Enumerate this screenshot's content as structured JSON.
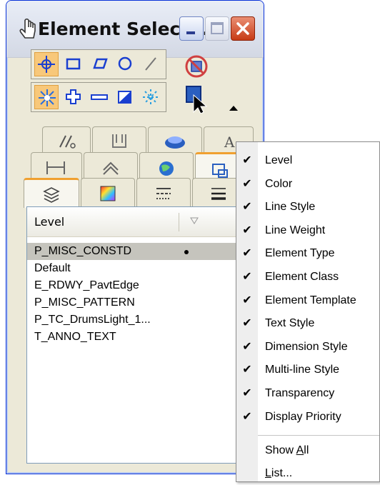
{
  "window": {
    "title": "Element Select...",
    "icon": "hand-pointer-icon"
  },
  "title_buttons": [
    "minimize-icon",
    "maximize-icon",
    "close-icon"
  ],
  "toolbar": {
    "row1": [
      "element-select-icon",
      "rectangle-select-icon",
      "shape-select-icon",
      "circle-select-icon",
      "line-select-icon"
    ],
    "row2": [
      "individual-mode-icon",
      "add-mode-icon",
      "subtract-mode-icon",
      "invert-mode-icon",
      "clear-mode-icon"
    ],
    "side": [
      "deselect-all-icon",
      "select-all-icon",
      "collapse-arrow-icon"
    ]
  },
  "tabs": {
    "row1": [
      "element-class-tab",
      "element-template-tab",
      "transparency-tab",
      "text-style-tab"
    ],
    "row2": [
      "dimension-style-tab",
      "display-priority-tab",
      "color-tab-globe",
      "element-type-tab"
    ],
    "row3": [
      "level-tab",
      "color-tab",
      "line-style-tab",
      "line-weight-tab"
    ]
  },
  "list": {
    "column_header": "Level",
    "rows": [
      {
        "name": "P_MISC_CONSTD",
        "active": true
      },
      {
        "name": "Default",
        "active": false
      },
      {
        "name": "E_RDWY_PavtEdge",
        "active": false
      },
      {
        "name": "P_MISC_PATTERN",
        "active": false
      },
      {
        "name": "P_TC_DrumsLight_1...",
        "active": false
      },
      {
        "name": "T_ANNO_TEXT",
        "active": false
      }
    ]
  },
  "context_menu": {
    "items": [
      {
        "label": "Level",
        "checked": true
      },
      {
        "label": "Color",
        "checked": true
      },
      {
        "label": "Line Style",
        "checked": true
      },
      {
        "label": "Line Weight",
        "checked": true
      },
      {
        "label": "Element Type",
        "checked": true
      },
      {
        "label": "Element Class",
        "checked": true
      },
      {
        "label": "Element Template",
        "checked": true
      },
      {
        "label": "Text Style",
        "checked": true
      },
      {
        "label": "Dimension Style",
        "checked": true
      },
      {
        "label": "Multi-line Style",
        "checked": true
      },
      {
        "label": "Transparency",
        "checked": true
      },
      {
        "label": "Display Priority",
        "checked": true
      }
    ],
    "show_all": {
      "label_prefix": "Show ",
      "label_underlined": "A",
      "label_suffix": "ll"
    },
    "list": {
      "label_underlined": "L",
      "label_suffix": "ist..."
    }
  },
  "colors": {
    "title_blue": "#0831d9",
    "active_tool": "#f8c87a",
    "tab_highlight": "#f0a030",
    "selected_row": "#c5c4bd",
    "close_red": "#c73b15"
  }
}
